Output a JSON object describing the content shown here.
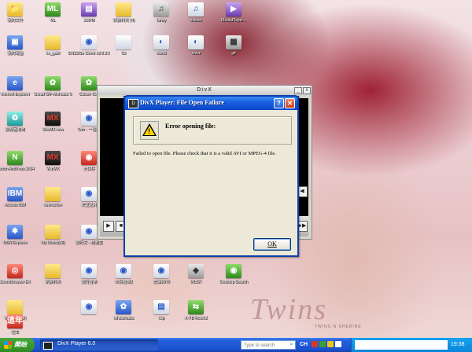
{
  "desktop": {
    "icons": [
      {
        "label": "我的文件",
        "glyph": "📁",
        "style": "g-folder"
      },
      {
        "label": "ML",
        "glyph": "ML",
        "style": "g-green"
      },
      {
        "label": "20048",
        "glyph": "▤",
        "style": "g-purple"
      },
      {
        "label": "新資料夾 (4)",
        "glyph": "",
        "style": "g-folder"
      },
      {
        "label": "fanzy",
        "glyph": "♫",
        "style": "g-gray"
      },
      {
        "label": "mlover",
        "glyph": "♫",
        "style": "g-white"
      },
      {
        "label": "MediaPlayer...",
        "glyph": "▶",
        "style": "g-purple"
      },
      {
        "label": "我的電腦",
        "glyph": "▣",
        "style": "g-blue"
      },
      {
        "label": "ck_gubf",
        "glyph": "",
        "style": "g-folder"
      },
      {
        "label": "DNS2Go Client v2.0.2.0",
        "glyph": "◉",
        "style": "g-white"
      },
      {
        "label": "03",
        "glyph": "",
        "style": "g-white"
      },
      {
        "label": "icon3",
        "glyph": "◐",
        "style": "g-white"
      },
      {
        "label": "lover",
        "glyph": "◐",
        "style": "g-white"
      },
      {
        "label": "gif",
        "glyph": "▦",
        "style": "g-gray"
      },
      {
        "label": "Internet Explorer",
        "glyph": "e",
        "style": "g-blue"
      },
      {
        "label": "Ulead GIF Animator 5",
        "glyph": "✿",
        "style": "g-green"
      },
      {
        "label": "Clicker ICQ",
        "glyph": "✿",
        "style": "g-green"
      },
      {
        "label": "資源回收筒",
        "glyph": "♻",
        "style": "g-teal"
      },
      {
        "label": "WinMX new",
        "glyph": "MX",
        "style": "g-mx"
      },
      {
        "label": "Tem - 一種 用",
        "glyph": "◉",
        "style": "g-white"
      },
      {
        "label": "Norton AntiVirus 2004",
        "glyph": "N",
        "style": "g-green"
      },
      {
        "label": "WinMX",
        "glyph": "MX",
        "style": "g-mx"
      },
      {
        "label": "大口仔",
        "glyph": "◉",
        "style": "g-red"
      },
      {
        "label": "Access IBM",
        "glyph": "IBM",
        "style": "g-blue"
      },
      {
        "label": "overcoffee",
        "glyph": "",
        "style": "g-folder"
      },
      {
        "label": "天堂之外",
        "glyph": "◉",
        "style": "g-white"
      },
      {
        "label": "MSN Explorer",
        "glyph": "✱",
        "style": "g-blue"
      },
      {
        "label": "My Music(36)",
        "glyph": "",
        "style": "g-folder"
      },
      {
        "label": "流行文 - 精選集",
        "glyph": "◉",
        "style": "g-white"
      },
      {
        "label": "ZoomBrowser EX",
        "glyph": "◎",
        "style": "g-red"
      },
      {
        "label": "新資料夾",
        "glyph": "",
        "style": "g-folder"
      },
      {
        "label": "流行音樂",
        "glyph": "◉",
        "style": "g-white"
      },
      {
        "label": "朱鳥音樂2",
        "glyph": "◉",
        "style": "g-white"
      },
      {
        "label": "洗澡1970",
        "glyph": "◉",
        "style": "g-white"
      },
      {
        "label": "MUST",
        "glyph": "◆",
        "style": "g-gray"
      },
      {
        "label": "Desktop Search",
        "glyph": "◉",
        "style": "g-green"
      },
      {
        "label": "新資料夾 (3)",
        "glyph": "",
        "style": "g-folder"
      },
      {
        "label": "",
        "glyph": "◉",
        "style": "g-white"
      },
      {
        "label": "ethicsmusic",
        "glyph": "✿",
        "style": "g-blue"
      },
      {
        "label": "clip",
        "glyph": "▤",
        "style": "g-white"
      },
      {
        "label": "X-TB Room2",
        "glyph": "⇆",
        "style": "g-green"
      },
      {
        "label": "這年",
        "glyph": "這年",
        "style": "g-red"
      }
    ],
    "watermark": "Twins",
    "watermark_small": "TWINS N SHERINE"
  },
  "player": {
    "title": "DivX",
    "minimize_label": "_",
    "close_label": "x",
    "controls": [
      "▶",
      "■",
      "◀◀",
      "▶▶",
      "◀"
    ]
  },
  "dialog": {
    "title": "DivX Player: File Open Failure",
    "app_icon": "D",
    "help_label": "?",
    "close_label": "✕",
    "warning_symbol": "!",
    "heading": "Error opening file:",
    "message": "Failed to open file. Please check that it is a valid AVI or MPEG-4 file.",
    "ok_label": "OK"
  },
  "taskbar": {
    "start_label": "開始",
    "task_label": "DivX Player 6.0",
    "search_placeholder": "Type to search",
    "lang": "CH",
    "clock": "19:38",
    "tray_colors": [
      "#d23b2b",
      "#3aa03a",
      "#f0c419",
      "#ffffff"
    ]
  }
}
